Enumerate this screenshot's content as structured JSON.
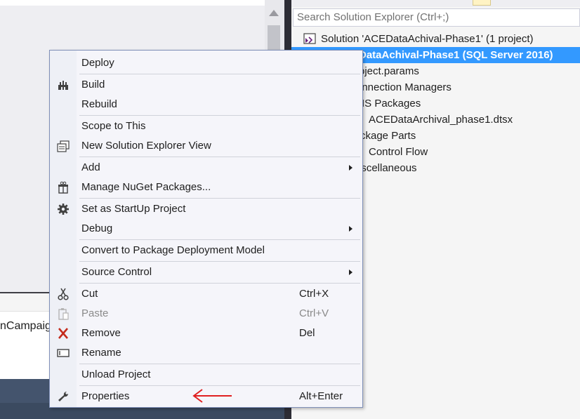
{
  "editor": {
    "lower_panel_text": "nCampaig"
  },
  "solution_explorer": {
    "search_placeholder": "Search Solution Explorer (Ctrl+;)",
    "tree": [
      {
        "label": "Solution 'ACEDataAchival-Phase1' (1 project)",
        "icon": "solution-icon"
      },
      {
        "label": "DataAchival-Phase1 (SQL Server 2016)",
        "selected": true
      },
      {
        "label": "oject.params"
      },
      {
        "label": "onnection Managers"
      },
      {
        "label": "IS Packages"
      },
      {
        "label": "ACEDataArchival_phase1.dtsx"
      },
      {
        "label": "ckage Parts"
      },
      {
        "label": "Control Flow"
      },
      {
        "label": "iscellaneous"
      }
    ]
  },
  "context_menu": {
    "items": [
      {
        "label": "Deploy"
      },
      {
        "label": "Build",
        "icon": "build-icon"
      },
      {
        "label": "Rebuild"
      },
      {
        "label": "Scope to This"
      },
      {
        "label": "New Solution Explorer View",
        "icon": "new-view-icon"
      },
      {
        "label": "Add",
        "submenu": true
      },
      {
        "label": "Manage NuGet Packages...",
        "icon": "nuget-icon"
      },
      {
        "label": "Set as StartUp Project",
        "icon": "gear-icon"
      },
      {
        "label": "Debug",
        "submenu": true
      },
      {
        "label": "Convert to Package Deployment Model"
      },
      {
        "label": "Source Control",
        "submenu": true
      },
      {
        "label": "Cut",
        "shortcut": "Ctrl+X",
        "icon": "scissors-icon"
      },
      {
        "label": "Paste",
        "shortcut": "Ctrl+V",
        "icon": "clipboard-icon",
        "disabled": true
      },
      {
        "label": "Remove",
        "shortcut": "Del",
        "icon": "red-x-icon"
      },
      {
        "label": "Rename",
        "icon": "rename-icon"
      },
      {
        "label": "Unload Project"
      },
      {
        "label": "Properties",
        "shortcut": "Alt+Enter",
        "icon": "wrench-icon"
      }
    ]
  },
  "colors": {
    "selection": "#3399ff",
    "annotation_arrow": "#e02020",
    "status_bar": "#44546d"
  }
}
